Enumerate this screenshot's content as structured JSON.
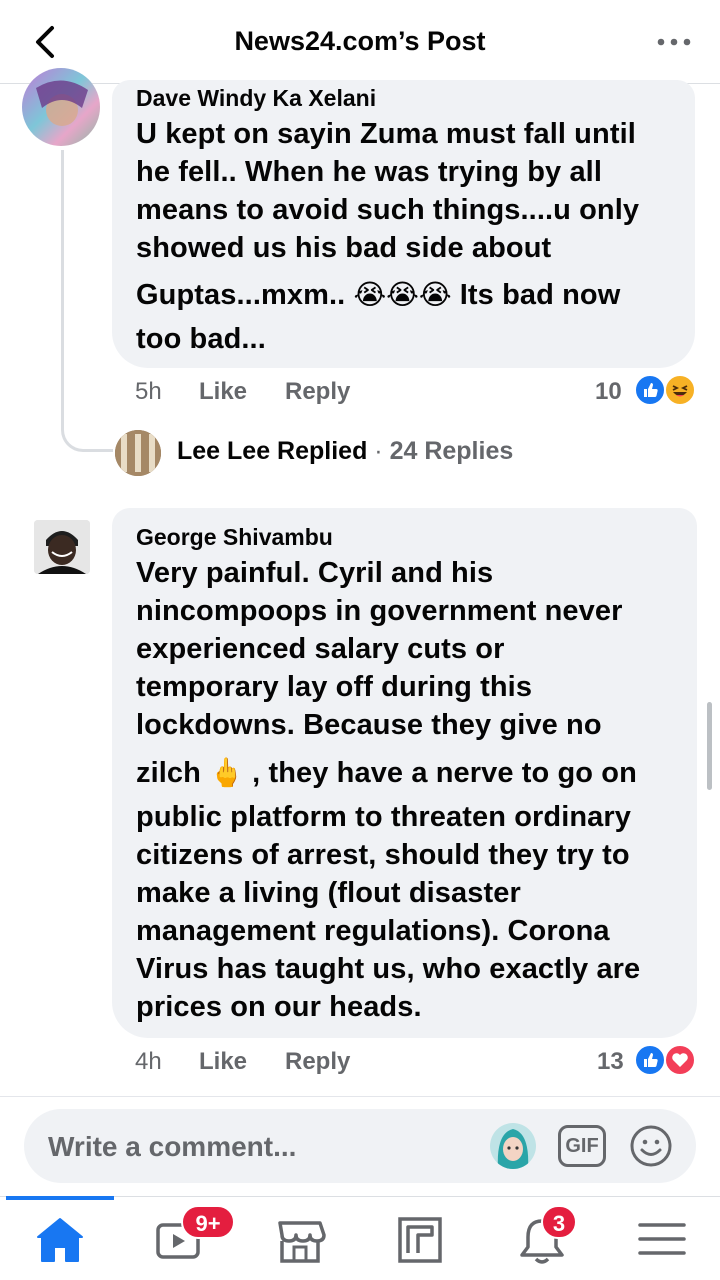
{
  "header": {
    "title": "News24.com’s Post",
    "back_icon": "chevron-left-icon",
    "more_icon": "more-horizontal-icon"
  },
  "comments": [
    {
      "author": "Dave Windy Ka Xelani",
      "lines": [
        "U kept on sayin Zuma must fall until",
        "he fell.. When he was trying by all",
        "means to avoid such things....u only",
        "showed us his bad side about",
        "Guptas...mxm.. ",
        "too bad..."
      ],
      "emoji_inline": "😭😭😭",
      "line5_tail": " Its bad now",
      "time": "5h",
      "like_label": "Like",
      "reply_label": "Reply",
      "reaction_count": "10",
      "reactions": [
        "like",
        "haha"
      ]
    },
    {
      "author": "George Shivambu",
      "lines": [
        "Very painful. Cyril and his",
        "nincompoops in government never",
        "experienced salary cuts or",
        "temporary lay off during this",
        "lockdowns. Because they give no",
        "zilch ",
        "public platform to threaten ordinary",
        "citizens of arrest, should they try to",
        "make a living (flout disaster",
        "management regulations). Corona",
        "Virus has taught us, who exactly are",
        "prices on our heads."
      ],
      "emoji_inline": "🖕",
      "line6_tail": " , they have a nerve to go on",
      "time": "4h",
      "like_label": "Like",
      "reply_label": "Reply",
      "reaction_count": "13",
      "reactions": [
        "like",
        "love"
      ]
    }
  ],
  "replies_summary": {
    "name": "Lee Lee",
    "action": " Replied",
    "separator": " · ",
    "count_label": "24 Replies"
  },
  "composer": {
    "placeholder": "Write a comment...",
    "gif_label": "GIF",
    "icons": [
      "avatar-sticker-icon",
      "gif-icon",
      "emoji-icon"
    ]
  },
  "bottom_nav": {
    "items": [
      "home-icon",
      "watch-icon",
      "marketplace-icon",
      "news-feed-icon",
      "notifications-icon",
      "menu-icon"
    ],
    "watch_badge": "9+",
    "notifications_badge": "3",
    "active": "home"
  },
  "colors": {
    "accent": "#1877f2",
    "bubble": "#f0f2f5",
    "muted_text": "#65676b",
    "badge": "#e41e3f",
    "love": "#f33e58",
    "haha": "#f7b125"
  }
}
